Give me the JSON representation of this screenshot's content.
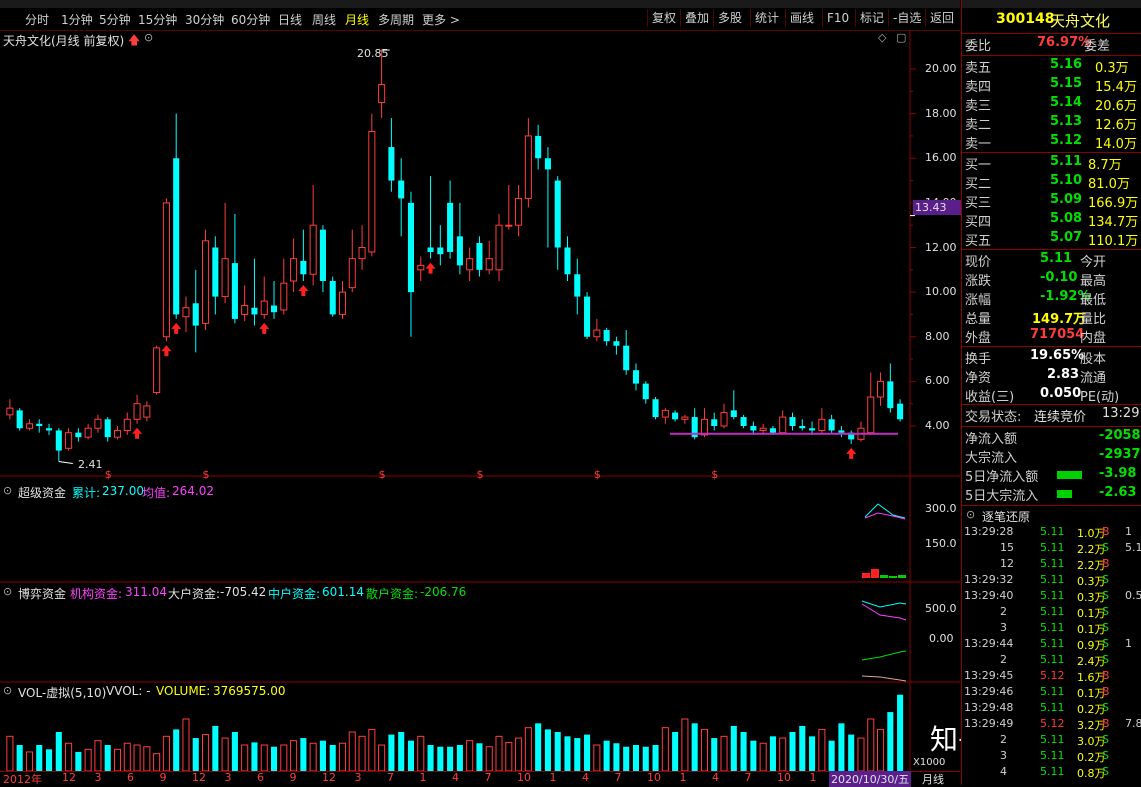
{
  "toolbar": {
    "periods": [
      "分时",
      "1分钟",
      "5分钟",
      "15分钟",
      "30分钟",
      "60分钟",
      "日线",
      "周线",
      "月线",
      "多周期",
      "更多 >"
    ],
    "active_period": "月线",
    "right_buttons": [
      "复权",
      "叠加",
      "多股",
      "统计",
      "画线",
      "F10",
      "标记",
      "-自选",
      "返回"
    ]
  },
  "chart_header": {
    "title": "天舟文化(月线 前复权)",
    "high_label": "20.85",
    "low_label": "2.41",
    "current_price_tag": "13.43"
  },
  "price_axis": [
    "20.00",
    "18.00",
    "16.00",
    "14.00",
    "12.00",
    "10.00",
    "8.00",
    "6.00",
    "4.00"
  ],
  "panels": {
    "super_fund": {
      "name": "超级资金",
      "cum_label": "累计:",
      "cum_value": "237.00",
      "avg_label": "均值:",
      "avg_value": "264.02",
      "axis": [
        "300.0",
        "150.0"
      ]
    },
    "game_fund": {
      "name": "博弈资金",
      "inst_label": "机构资金:",
      "inst_value": "311.04",
      "large_label": "大户资金:",
      "large_value": "-705.42",
      "mid_label": "中户资金:",
      "mid_value": "601.14",
      "retail_label": "散户资金:",
      "retail_value": "-206.76",
      "axis": [
        "500.0",
        "0.00"
      ]
    },
    "volume": {
      "name": "VOL-虚拟(5,10)",
      "vvol": "VVOL: -",
      "volume_label": "VOLUME:",
      "volume_value": "3769575.00",
      "axis": [
        "X1000"
      ]
    }
  },
  "time_axis": {
    "start": "2012年",
    "labels": [
      "12",
      "3",
      "6",
      "9",
      "12",
      "3",
      "6",
      "9",
      "12",
      "3",
      "7",
      "1",
      "4",
      "7",
      "10",
      "1",
      "4",
      "7",
      "10",
      "1",
      "4",
      "7",
      "10",
      "1"
    ],
    "end_date": "2020/10/30/五",
    "period_tab": "月线"
  },
  "chart_data": {
    "type": "candlestick",
    "title": "",
    "ylim": [
      2.0,
      22.0
    ],
    "candles": [
      {
        "o": 4.5,
        "c": 4.8,
        "h": 5.2,
        "l": 4.3
      },
      {
        "o": 4.7,
        "c": 3.9,
        "h": 4.8,
        "l": 3.8
      },
      {
        "o": 3.9,
        "c": 4.1,
        "h": 4.3,
        "l": 3.8
      },
      {
        "o": 4.1,
        "c": 4.0,
        "h": 4.3,
        "l": 3.7
      },
      {
        "o": 3.9,
        "c": 3.8,
        "h": 4.1,
        "l": 3.6
      },
      {
        "o": 3.8,
        "c": 2.9,
        "h": 3.9,
        "l": 2.41
      },
      {
        "o": 3.0,
        "c": 3.7,
        "h": 3.9,
        "l": 2.9
      },
      {
        "o": 3.7,
        "c": 3.5,
        "h": 3.9,
        "l": 3.3
      },
      {
        "o": 3.5,
        "c": 3.9,
        "h": 4.1,
        "l": 3.4
      },
      {
        "o": 3.9,
        "c": 4.3,
        "h": 4.5,
        "l": 3.7
      },
      {
        "o": 4.3,
        "c": 3.5,
        "h": 4.4,
        "l": 3.3
      },
      {
        "o": 3.5,
        "c": 3.8,
        "h": 4.0,
        "l": 3.4
      },
      {
        "o": 3.8,
        "c": 4.3,
        "h": 4.6,
        "l": 3.6
      },
      {
        "o": 4.3,
        "c": 5.0,
        "h": 5.4,
        "l": 4.1
      },
      {
        "o": 4.4,
        "c": 4.9,
        "h": 5.1,
        "l": 4.2
      },
      {
        "o": 5.5,
        "c": 7.5,
        "h": 7.6,
        "l": 5.4
      },
      {
        "o": 8.0,
        "c": 14.0,
        "h": 14.2,
        "l": 7.8
      },
      {
        "o": 16.0,
        "c": 9.0,
        "h": 18.0,
        "l": 8.8
      },
      {
        "o": 8.9,
        "c": 9.3,
        "h": 9.8,
        "l": 8.2
      },
      {
        "o": 9.5,
        "c": 8.5,
        "h": 11.0,
        "l": 7.3
      },
      {
        "o": 8.6,
        "c": 12.3,
        "h": 12.8,
        "l": 8.3
      },
      {
        "o": 12.0,
        "c": 9.8,
        "h": 12.5,
        "l": 9.0
      },
      {
        "o": 9.8,
        "c": 11.5,
        "h": 14.0,
        "l": 9.5
      },
      {
        "o": 11.3,
        "c": 8.8,
        "h": 13.5,
        "l": 8.6
      },
      {
        "o": 9.0,
        "c": 9.4,
        "h": 10.3,
        "l": 8.7
      },
      {
        "o": 9.3,
        "c": 9.0,
        "h": 11.5,
        "l": 8.5
      },
      {
        "o": 9.0,
        "c": 9.6,
        "h": 10.7,
        "l": 8.8
      },
      {
        "o": 9.4,
        "c": 9.1,
        "h": 10.5,
        "l": 8.8
      },
      {
        "o": 9.2,
        "c": 10.4,
        "h": 11.5,
        "l": 9.0
      },
      {
        "o": 10.5,
        "c": 11.5,
        "h": 12.4,
        "l": 10.0
      },
      {
        "o": 11.4,
        "c": 10.8,
        "h": 12.8,
        "l": 10.5
      },
      {
        "o": 10.8,
        "c": 13.0,
        "h": 14.8,
        "l": 10.3
      },
      {
        "o": 12.8,
        "c": 10.5,
        "h": 13.0,
        "l": 10.0
      },
      {
        "o": 10.5,
        "c": 9.0,
        "h": 10.7,
        "l": 8.9
      },
      {
        "o": 9.0,
        "c": 10.0,
        "h": 10.5,
        "l": 8.8
      },
      {
        "o": 10.2,
        "c": 11.5,
        "h": 12.8,
        "l": 10.0
      },
      {
        "o": 11.5,
        "c": 12.0,
        "h": 13.0,
        "l": 11.0
      },
      {
        "o": 11.8,
        "c": 17.2,
        "h": 18.0,
        "l": 11.6
      },
      {
        "o": 18.5,
        "c": 19.3,
        "h": 20.85,
        "l": 17.8
      },
      {
        "o": 16.5,
        "c": 15.0,
        "h": 17.8,
        "l": 14.5
      },
      {
        "o": 15.0,
        "c": 14.2,
        "h": 16.0,
        "l": 12.5
      },
      {
        "o": 14.0,
        "c": 10.0,
        "h": 14.5,
        "l": 8.0
      },
      {
        "o": 11.0,
        "c": 11.2,
        "h": 11.6,
        "l": 10.5
      },
      {
        "o": 12.0,
        "c": 11.8,
        "h": 15.2,
        "l": 11.5
      },
      {
        "o": 12.0,
        "c": 11.7,
        "h": 13.0,
        "l": 11.2
      },
      {
        "o": 14.0,
        "c": 11.8,
        "h": 15.0,
        "l": 11.5
      },
      {
        "o": 12.5,
        "c": 11.2,
        "h": 14.0,
        "l": 10.8
      },
      {
        "o": 11.0,
        "c": 11.5,
        "h": 12.0,
        "l": 10.5
      },
      {
        "o": 12.2,
        "c": 11.0,
        "h": 12.5,
        "l": 10.7
      },
      {
        "o": 11.0,
        "c": 11.5,
        "h": 12.3,
        "l": 10.8
      },
      {
        "o": 11.0,
        "c": 13.0,
        "h": 13.5,
        "l": 10.5
      },
      {
        "o": 13.0,
        "c": 13.0,
        "h": 14.8,
        "l": 12.8
      },
      {
        "o": 13.0,
        "c": 14.2,
        "h": 14.8,
        "l": 12.5
      },
      {
        "o": 14.2,
        "c": 17.0,
        "h": 17.8,
        "l": 13.8
      },
      {
        "o": 17.0,
        "c": 16.0,
        "h": 17.5,
        "l": 15.5
      },
      {
        "o": 16.0,
        "c": 15.5,
        "h": 16.5,
        "l": 12.0
      },
      {
        "o": 15.0,
        "c": 12.0,
        "h": 15.2,
        "l": 11.0
      },
      {
        "o": 12.0,
        "c": 10.8,
        "h": 12.5,
        "l": 10.5
      },
      {
        "o": 10.8,
        "c": 9.8,
        "h": 11.5,
        "l": 9.0
      },
      {
        "o": 9.8,
        "c": 8.0,
        "h": 10.0,
        "l": 7.9
      },
      {
        "o": 8.0,
        "c": 8.3,
        "h": 8.8,
        "l": 7.8
      },
      {
        "o": 8.3,
        "c": 7.8,
        "h": 8.4,
        "l": 7.6
      },
      {
        "o": 7.8,
        "c": 7.6,
        "h": 8.0,
        "l": 7.2
      },
      {
        "o": 7.6,
        "c": 6.5,
        "h": 8.3,
        "l": 6.3
      },
      {
        "o": 6.5,
        "c": 5.9,
        "h": 6.8,
        "l": 5.6
      },
      {
        "o": 5.9,
        "c": 5.2,
        "h": 6.0,
        "l": 5.0
      },
      {
        "o": 5.2,
        "c": 4.4,
        "h": 5.3,
        "l": 4.3
      },
      {
        "o": 4.4,
        "c": 4.7,
        "h": 4.8,
        "l": 4.1
      },
      {
        "o": 4.6,
        "c": 4.3,
        "h": 4.7,
        "l": 4.2
      },
      {
        "o": 4.3,
        "c": 4.4,
        "h": 4.5,
        "l": 4.1
      },
      {
        "o": 4.4,
        "c": 3.5,
        "h": 4.8,
        "l": 3.4
      },
      {
        "o": 3.6,
        "c": 4.3,
        "h": 4.8,
        "l": 3.5
      },
      {
        "o": 4.3,
        "c": 4.0,
        "h": 4.6,
        "l": 3.8
      },
      {
        "o": 4.0,
        "c": 4.6,
        "h": 5.0,
        "l": 3.9
      },
      {
        "o": 4.7,
        "c": 4.4,
        "h": 5.6,
        "l": 4.3
      },
      {
        "o": 4.4,
        "c": 4.0,
        "h": 4.5,
        "l": 3.9
      },
      {
        "o": 4.0,
        "c": 3.8,
        "h": 4.2,
        "l": 3.6
      },
      {
        "o": 3.8,
        "c": 3.9,
        "h": 4.1,
        "l": 3.6
      },
      {
        "o": 3.9,
        "c": 3.7,
        "h": 4.0,
        "l": 3.6
      },
      {
        "o": 3.7,
        "c": 4.4,
        "h": 4.7,
        "l": 3.7
      },
      {
        "o": 4.4,
        "c": 4.0,
        "h": 4.6,
        "l": 3.8
      },
      {
        "o": 4.0,
        "c": 3.9,
        "h": 4.3,
        "l": 3.8
      },
      {
        "o": 3.9,
        "c": 3.8,
        "h": 4.2,
        "l": 3.6
      },
      {
        "o": 3.8,
        "c": 4.3,
        "h": 4.8,
        "l": 3.7
      },
      {
        "o": 4.3,
        "c": 3.8,
        "h": 4.5,
        "l": 3.7
      },
      {
        "o": 3.8,
        "c": 3.7,
        "h": 4.0,
        "l": 3.5
      },
      {
        "o": 3.7,
        "c": 3.4,
        "h": 3.8,
        "l": 3.2
      },
      {
        "o": 3.4,
        "c": 3.9,
        "h": 4.2,
        "l": 3.3
      },
      {
        "o": 3.7,
        "c": 5.3,
        "h": 6.4,
        "l": 3.6
      },
      {
        "o": 5.3,
        "c": 6.0,
        "h": 6.4,
        "l": 4.9
      },
      {
        "o": 6.0,
        "c": 4.8,
        "h": 6.8,
        "l": 4.6
      },
      {
        "o": 5.0,
        "c": 4.3,
        "h": 5.2,
        "l": 4.2
      }
    ],
    "up_arrows_at": [
      13,
      16,
      17,
      26,
      30,
      43,
      86
    ],
    "s_marks_at": [
      10,
      20,
      38,
      48,
      60,
      72
    ],
    "volumes": [
      40,
      30,
      22,
      30,
      25,
      45,
      32,
      22,
      25,
      35,
      30,
      25,
      32,
      30,
      28,
      20,
      40,
      48,
      60,
      38,
      42,
      52,
      38,
      45,
      30,
      33,
      30,
      28,
      30,
      35,
      38,
      32,
      35,
      30,
      32,
      45,
      40,
      48,
      30,
      42,
      45,
      35,
      40,
      30,
      28,
      28,
      30,
      35,
      32,
      28,
      40,
      33,
      38,
      50,
      55,
      48,
      45,
      40,
      38,
      42,
      30,
      35,
      32,
      28,
      30,
      28,
      30,
      50,
      45,
      60,
      55,
      48,
      38,
      40,
      52,
      45,
      35,
      32,
      40,
      38,
      45,
      52,
      40,
      48,
      35,
      55,
      42,
      38,
      60,
      48,
      68,
      88,
      80,
      62,
      30
    ]
  },
  "right_panel": {
    "code": "300148",
    "name": "天舟文化",
    "weibi_label": "委比",
    "weibi_value": "76.97%",
    "weicha_label": "委差",
    "sells": [
      {
        "label": "卖五",
        "price": "5.16",
        "vol": "0.3万"
      },
      {
        "label": "卖四",
        "price": "5.15",
        "vol": "15.4万"
      },
      {
        "label": "卖三",
        "price": "5.14",
        "vol": "20.6万"
      },
      {
        "label": "卖二",
        "price": "5.13",
        "vol": "12.6万"
      },
      {
        "label": "卖一",
        "price": "5.12",
        "vol": "14.0万"
      }
    ],
    "buys": [
      {
        "label": "买一",
        "price": "5.11",
        "vol": "8.7万"
      },
      {
        "label": "买二",
        "price": "5.10",
        "vol": "81.0万"
      },
      {
        "label": "买三",
        "price": "5.09",
        "vol": "166.9万"
      },
      {
        "label": "买四",
        "price": "5.08",
        "vol": "134.7万"
      },
      {
        "label": "买五",
        "price": "5.07",
        "vol": "110.1万"
      }
    ],
    "quote": [
      {
        "k": "现价",
        "v": "5.11",
        "k2": "今开"
      },
      {
        "k": "涨跌",
        "v": "-0.10",
        "k2": "最高"
      },
      {
        "k": "涨幅",
        "v": "-1.92%",
        "k2": "最低"
      },
      {
        "k": "总量",
        "v": "149.7万",
        "k2": "量比"
      },
      {
        "k": "外盘",
        "v": "717054",
        "k2": "内盘"
      }
    ],
    "stats": [
      {
        "k": "换手",
        "v": "19.65%",
        "k2": "股本"
      },
      {
        "k": "净资",
        "v": "2.83",
        "k2": "流通"
      },
      {
        "k": "收益(三)",
        "v": "0.050",
        "k2": "PE(动)"
      }
    ],
    "trade_state_label": "交易状态:",
    "trade_state": "连续竞价",
    "trade_time": "13:29",
    "flows": [
      {
        "k": "净流入额",
        "v": "-2058"
      },
      {
        "k": "大宗流入",
        "v": "-2937"
      },
      {
        "k": "5日净流入额",
        "v": "-3.98"
      },
      {
        "k": "5日大宗流入",
        "v": "-2.63"
      }
    ],
    "ticks_title": "逐笔还原",
    "ticks": [
      {
        "t": "13:29:28",
        "p": "5.11",
        "v": "1.0万",
        "s": "B",
        "x": "1"
      },
      {
        "t": "15",
        "p": "5.11",
        "v": "2.2万",
        "s": "S",
        "x": "5.1"
      },
      {
        "t": "12",
        "p": "5.11",
        "v": "2.2万",
        "s": "B",
        "x": ""
      },
      {
        "t": "13:29:32",
        "p": "5.11",
        "v": "0.3万",
        "s": "S",
        "x": ""
      },
      {
        "t": "13:29:40",
        "p": "5.11",
        "v": "0.3万",
        "s": "S",
        "x": "0.5"
      },
      {
        "t": "2",
        "p": "5.11",
        "v": "0.1万",
        "s": "S",
        "x": ""
      },
      {
        "t": "3",
        "p": "5.11",
        "v": "0.1万",
        "s": "S",
        "x": ""
      },
      {
        "t": "13:29:44",
        "p": "5.11",
        "v": "0.9万",
        "s": "S",
        "x": "1"
      },
      {
        "t": "2",
        "p": "5.11",
        "v": "2.4万",
        "s": "S",
        "x": ""
      },
      {
        "t": "13:29:45",
        "p": "5.12",
        "v": "1.6万",
        "s": "B",
        "x": ""
      },
      {
        "t": "13:29:46",
        "p": "5.11",
        "v": "0.1万",
        "s": "B",
        "x": ""
      },
      {
        "t": "13:29:48",
        "p": "5.11",
        "v": "0.2万",
        "s": "S",
        "x": ""
      },
      {
        "t": "13:29:49",
        "p": "5.12",
        "v": "3.2万",
        "s": "B",
        "x": "7.8"
      },
      {
        "t": "2",
        "p": "5.11",
        "v": "3.0万",
        "s": "S",
        "x": ""
      },
      {
        "t": "3",
        "p": "5.11",
        "v": "0.2万",
        "s": "S",
        "x": ""
      },
      {
        "t": "4",
        "p": "5.11",
        "v": "0.8万",
        "s": "S",
        "x": ""
      }
    ]
  },
  "watermark": "知乎 @叶修",
  "colors": {
    "up": "#ff3c3c",
    "down": "#00ffff",
    "axis_red": "#8b0000",
    "price_tag_bg": "#5a1f8a",
    "support_line": "#c030c0"
  }
}
